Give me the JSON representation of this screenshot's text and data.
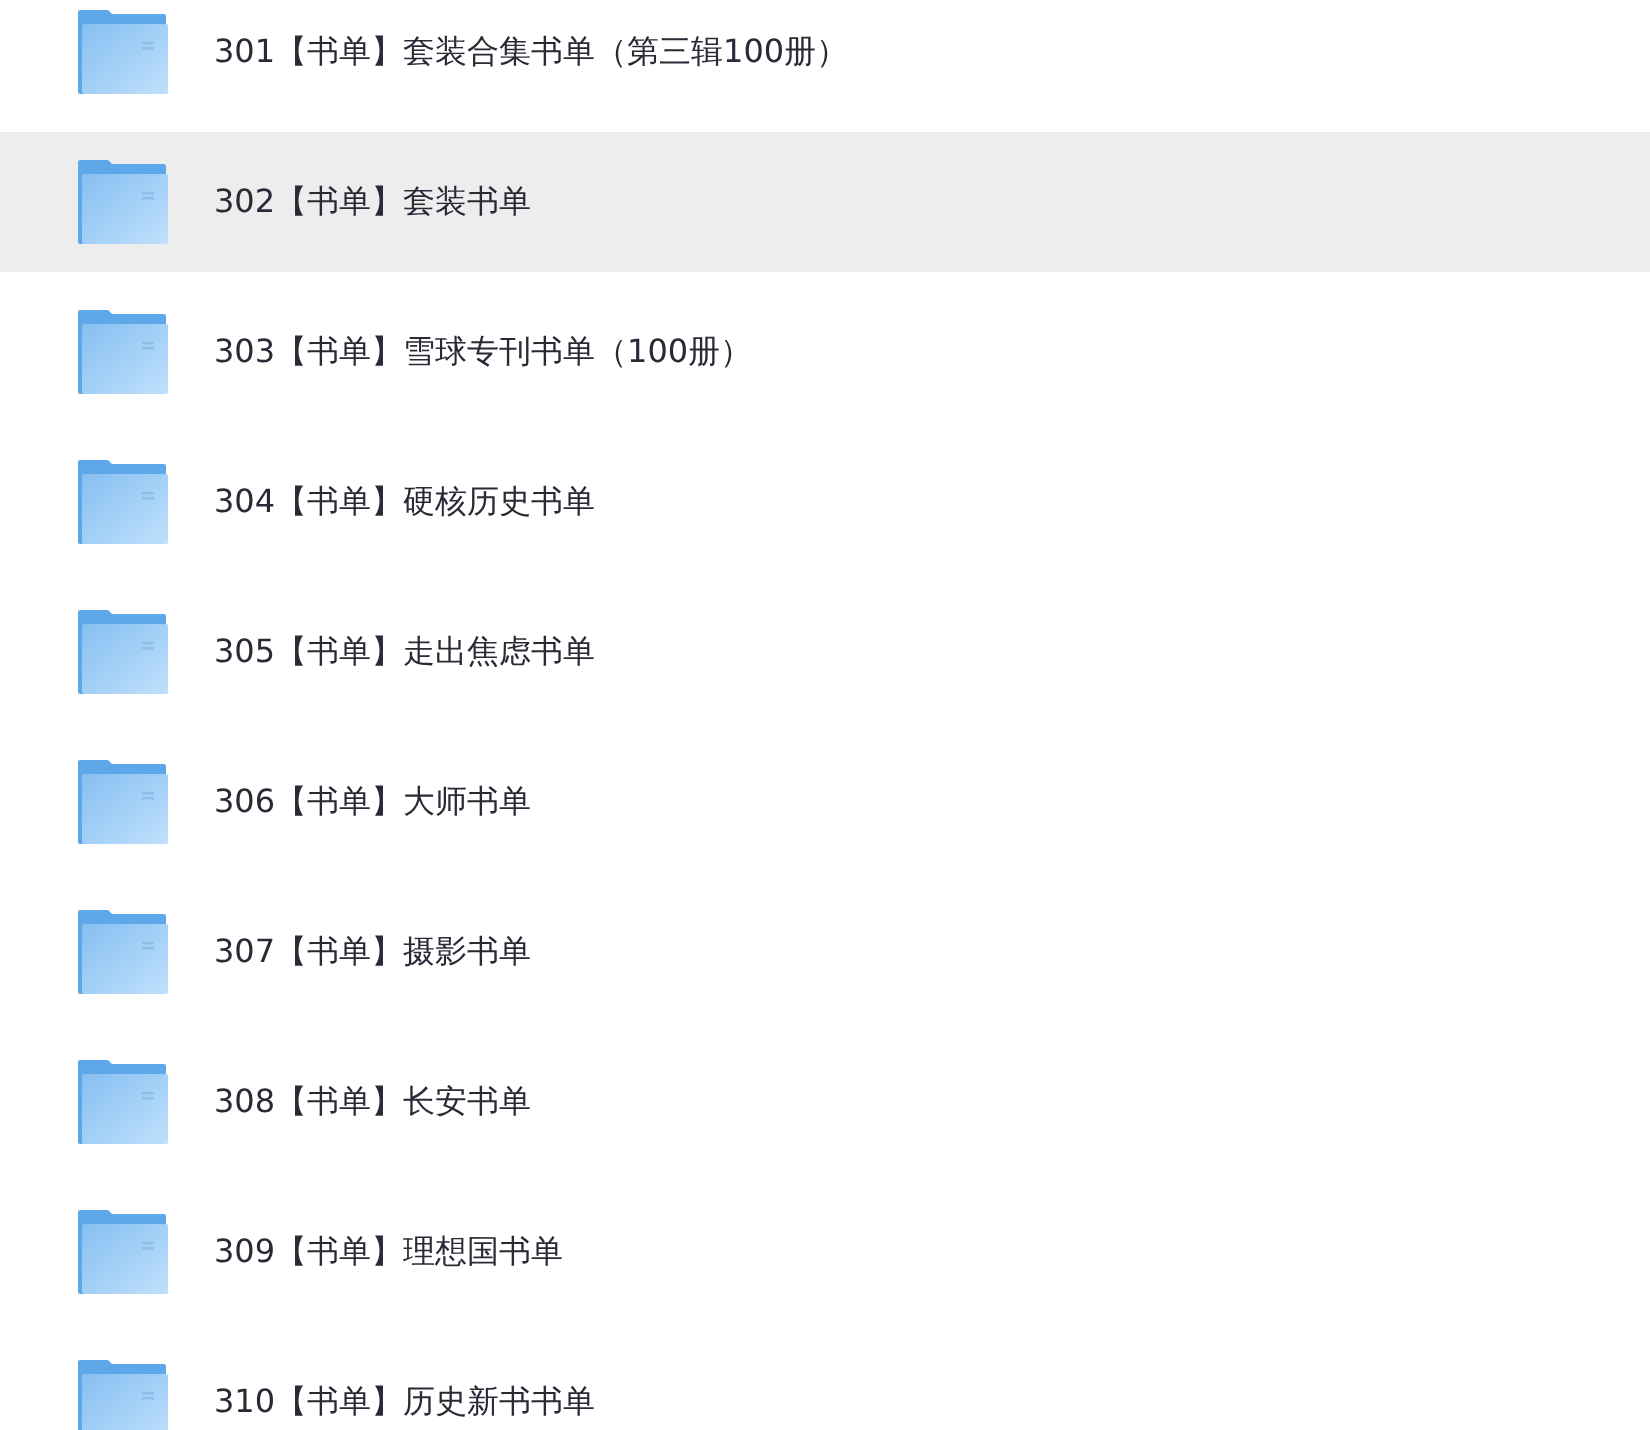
{
  "file_list": [
    {
      "name": "301【书单】套装合集书单（第三辑100册）",
      "selected": false
    },
    {
      "name": "302【书单】套装书单",
      "selected": true
    },
    {
      "name": "303【书单】雪球专刊书单（100册）",
      "selected": false
    },
    {
      "name": "304【书单】硬核历史书单",
      "selected": false
    },
    {
      "name": "305【书单】走出焦虑书单",
      "selected": false
    },
    {
      "name": "306【书单】大师书单",
      "selected": false
    },
    {
      "name": "307【书单】摄影书单",
      "selected": false
    },
    {
      "name": "308【书单】长安书单",
      "selected": false
    },
    {
      "name": "309【书单】理想国书单",
      "selected": false
    },
    {
      "name": "310【书单】历史新书书单",
      "selected": false
    }
  ]
}
